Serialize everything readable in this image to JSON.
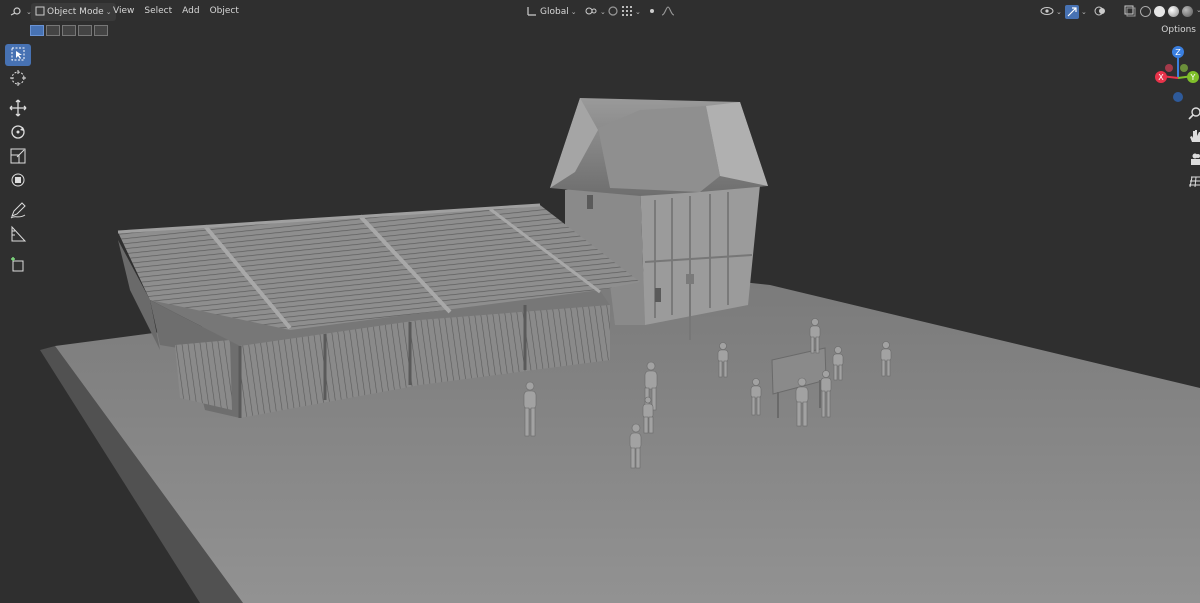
{
  "header": {
    "mode_label": "Object Mode",
    "menus": [
      "View",
      "Select",
      "Add",
      "Object"
    ],
    "orientation_label": "Global",
    "options_label": "Options"
  },
  "gizmo": {
    "x_label": "X",
    "y_label": "Y",
    "z_label": "Z",
    "x_color": "#e8334a",
    "y_color": "#7fbf2a",
    "z_color": "#3a7fe0"
  },
  "toolbar": {
    "tools": [
      "select-box",
      "cursor",
      "move",
      "rotate",
      "scale",
      "transform",
      "annotate",
      "measure",
      "add-cube"
    ],
    "active_tool": "select-box"
  },
  "colors": {
    "background": "#2f2f2f",
    "ground": "#8c8c8c",
    "accent": "#4772b3"
  }
}
